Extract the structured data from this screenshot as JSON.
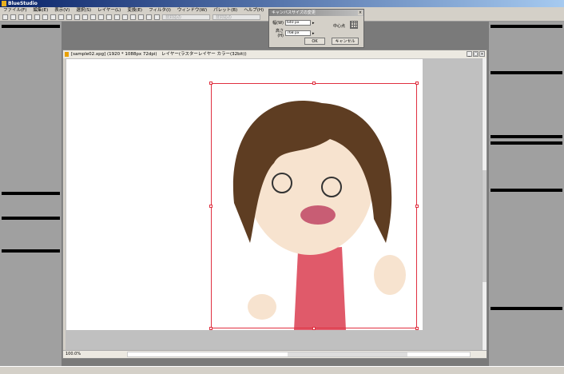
{
  "app": {
    "title": "BlueStudio"
  },
  "menu": [
    "ファイル(F)",
    "編集(E)",
    "表示(V)",
    "選択(S)",
    "レイヤー(L)",
    "変換(E)",
    "フィルタ(I)",
    "ウィンドウ(W)",
    "パレット(B)",
    "ヘルプ(H)"
  ],
  "toolbar": {
    "select1": "非対応の",
    "select2": "非対応の"
  },
  "dialog": {
    "title": "キャンバスサイズの変更",
    "width_label": "幅(W)",
    "width_value": "640 px",
    "height_label": "高さ(H)",
    "height_value": "768 px",
    "anchor_label": "中心点",
    "ok": "OK",
    "cancel": "キャンセル"
  },
  "document": {
    "title": "[sample02.xpg] (1920 * 1088px 72dpi)　レイヤー(ラスターレイヤー カラー(32bit))",
    "zoom": "100.0%"
  }
}
